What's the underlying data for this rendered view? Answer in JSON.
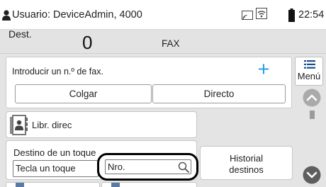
{
  "status_bar": {
    "user": "Usuario: DeviceAdmin, 4000",
    "time": "22:54"
  },
  "destination": {
    "label": "Dest.",
    "count": "0",
    "mode": "FAX"
  },
  "fax_entry": {
    "prompt": "Introducir un n.º de fax.",
    "hangup_label": "Colgar",
    "direct_label": "Directo"
  },
  "side_panel": {
    "menu_label": "Menú"
  },
  "address_book": {
    "label": "Libr. direc"
  },
  "one_touch": {
    "title": "Destino de un toque",
    "button_label": "Tecla un toque",
    "search_placeholder": "Nro."
  },
  "history": {
    "label_line1": "Historial",
    "label_line2": "destinos"
  },
  "colors": {
    "accent": "#2a9fe6",
    "scroll": "#9b9b9b"
  }
}
